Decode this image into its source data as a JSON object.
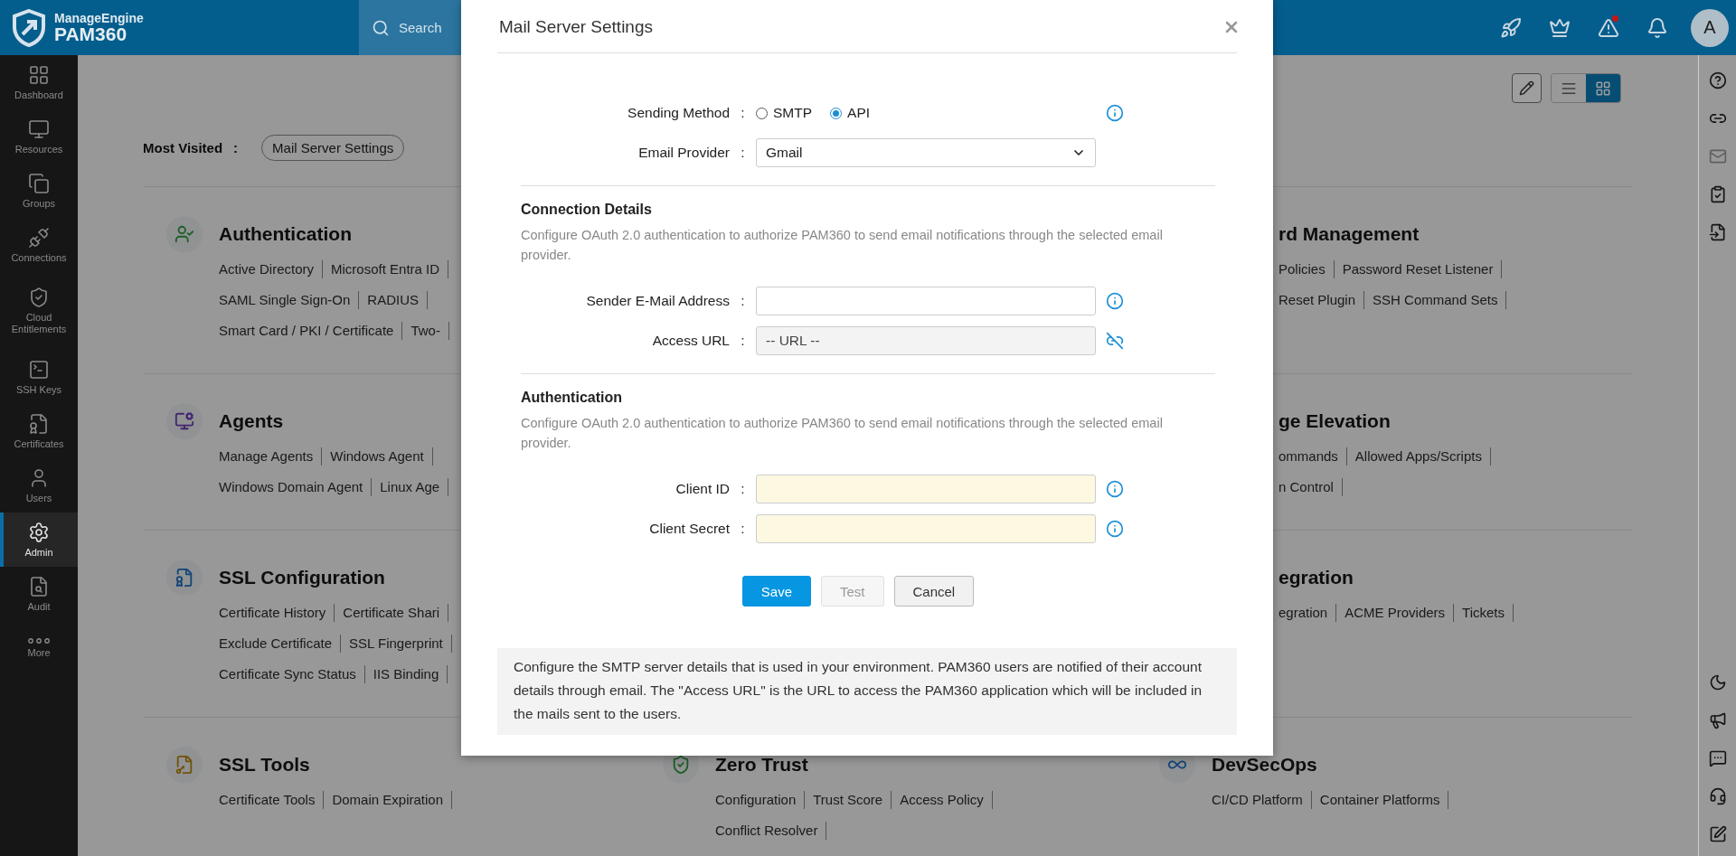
{
  "header": {
    "brand_top": "ManageEngine",
    "brand_bottom": "PAM360",
    "search_placeholder": "Search",
    "alert_unread": true,
    "avatar": "A"
  },
  "sidebar": {
    "items": [
      {
        "label": "Dashboard",
        "selected": false
      },
      {
        "label": "Resources",
        "selected": false
      },
      {
        "label": "Groups",
        "selected": false
      },
      {
        "label": "Connections",
        "selected": false
      },
      {
        "label": "Cloud Entitlements",
        "selected": false
      },
      {
        "label": "SSH Keys",
        "selected": false
      },
      {
        "label": "Certificates",
        "selected": false
      },
      {
        "label": "Users",
        "selected": false
      },
      {
        "label": "Admin",
        "selected": true
      },
      {
        "label": "Audit",
        "selected": false
      },
      {
        "label": "More",
        "selected": false
      }
    ]
  },
  "view_toggle": [
    {
      "selected": false
    },
    {
      "selected": true
    }
  ],
  "most_visited": {
    "label": "Most Visited",
    "separator": ":",
    "items": [
      "Mail Server Settings"
    ]
  },
  "section_rows": [
    {
      "left": {
        "title": "Authentication",
        "lines": [
          [
            "Active Directory",
            "Microsoft Entra ID"
          ],
          [
            "SAML Single Sign-On",
            "RADIUS"
          ],
          [
            "Smart Card / PKI / Certificate",
            "Two-"
          ]
        ]
      },
      "right": {
        "title": "rd Management",
        "lines": [
          [
            "Policies",
            "Password Reset Listener"
          ],
          [
            "Reset Plugin",
            "SSH Command Sets"
          ]
        ]
      }
    },
    {
      "left": {
        "title": "Agents",
        "lines": [
          [
            "Manage Agents",
            "Windows Agent"
          ],
          [
            "Windows Domain Agent",
            "Linux Age"
          ]
        ]
      },
      "right": {
        "title": "ge Elevation",
        "lines": [
          [
            "ommands",
            "Allowed Apps/Scripts"
          ],
          [
            "n Control"
          ]
        ]
      }
    },
    {
      "left": {
        "title": "SSL Configuration",
        "lines": [
          [
            "Certificate History",
            "Certificate Shari"
          ],
          [
            "Exclude Certificate",
            "SSL Fingerprint"
          ],
          [
            "Certificate Sync Status",
            "IIS Binding"
          ]
        ]
      },
      "right": {
        "title": "egration",
        "lines": [
          [
            "egration",
            "ACME Providers",
            "Tickets"
          ]
        ]
      }
    },
    {
      "left": {
        "title": "SSL Tools",
        "lines": [
          [
            "Certificate Tools",
            "Domain Expiration"
          ]
        ]
      },
      "middle": {
        "title": "Zero Trust",
        "lines": [
          [
            "Configuration",
            "Trust Score",
            "Access Policy"
          ],
          [
            "Conflict Resolver"
          ]
        ]
      },
      "right": {
        "title": "DevSecOps",
        "lines": [
          [
            "CI/CD Platform",
            "Container Platforms"
          ]
        ]
      }
    }
  ],
  "modal": {
    "title": "Mail Server Settings",
    "groups": [
      {
        "rows": [
          {
            "kind": "radio",
            "label": "Sending Method",
            "separator": ":",
            "help": true,
            "options": [
              {
                "label": "SMTP",
                "selected": false
              },
              {
                "label": "API",
                "selected": true
              }
            ]
          },
          {
            "kind": "select",
            "label": "Email Provider",
            "separator": ":",
            "help": false,
            "value": "Gmail"
          }
        ]
      },
      {
        "heading": "Connection Details",
        "description": "Configure OAuth 2.0 authentication to authorize PAM360 to send email notifications through the selected email provider.",
        "rows": [
          {
            "kind": "input",
            "label": "Sender E-Mail Address",
            "separator": ":",
            "help": true
          },
          {
            "kind": "readonly",
            "label": "Access URL",
            "separator": ":",
            "help": false,
            "placeholder": "-- URL --"
          }
        ]
      },
      {
        "heading": "Authentication",
        "description": "Configure OAuth 2.0 authentication to authorize PAM360 to send email notifications through the selected email provider.",
        "rows": [
          {
            "kind": "required",
            "label": "Client ID",
            "separator": ":",
            "help": true
          },
          {
            "kind": "required",
            "label": "Client Secret",
            "separator": ":",
            "help": true
          }
        ]
      }
    ],
    "buttons": [
      {
        "label": "Save",
        "kind": "primary",
        "disabled": false
      },
      {
        "label": "Test",
        "kind": "default",
        "disabled": true
      },
      {
        "label": "Cancel",
        "kind": "default",
        "disabled": false
      }
    ],
    "note": "Configure the SMTP server details that is used in your environment. PAM360 users are notified of their account details through email. The \"Access URL\" is the URL to access the PAM360 application which will be included in the mails sent to the users."
  }
}
